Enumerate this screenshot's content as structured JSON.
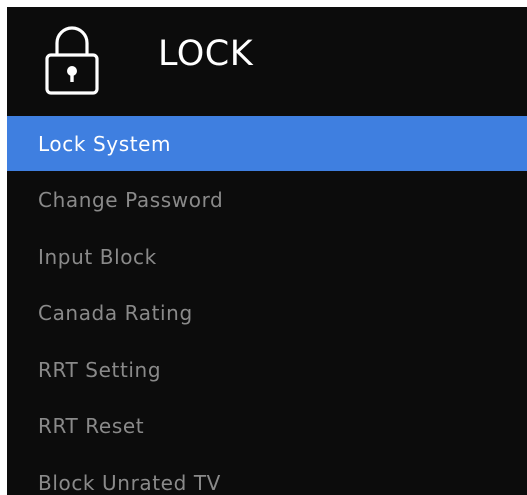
{
  "header": {
    "title": "LOCK",
    "icon": "lock-icon"
  },
  "menu": {
    "items": [
      {
        "label": "Lock System",
        "selected": true
      },
      {
        "label": "Change Password",
        "selected": false
      },
      {
        "label": "Input Block",
        "selected": false
      },
      {
        "label": "Canada Rating",
        "selected": false
      },
      {
        "label": "RRT Setting",
        "selected": false
      },
      {
        "label": "RRT Reset",
        "selected": false
      },
      {
        "label": "Block Unrated TV",
        "selected": false
      }
    ]
  },
  "colors": {
    "background": "#0c0c0c",
    "selected_bg": "#3f7fe0",
    "selected_text": "#ffffff",
    "item_text": "#8a8a8a"
  }
}
